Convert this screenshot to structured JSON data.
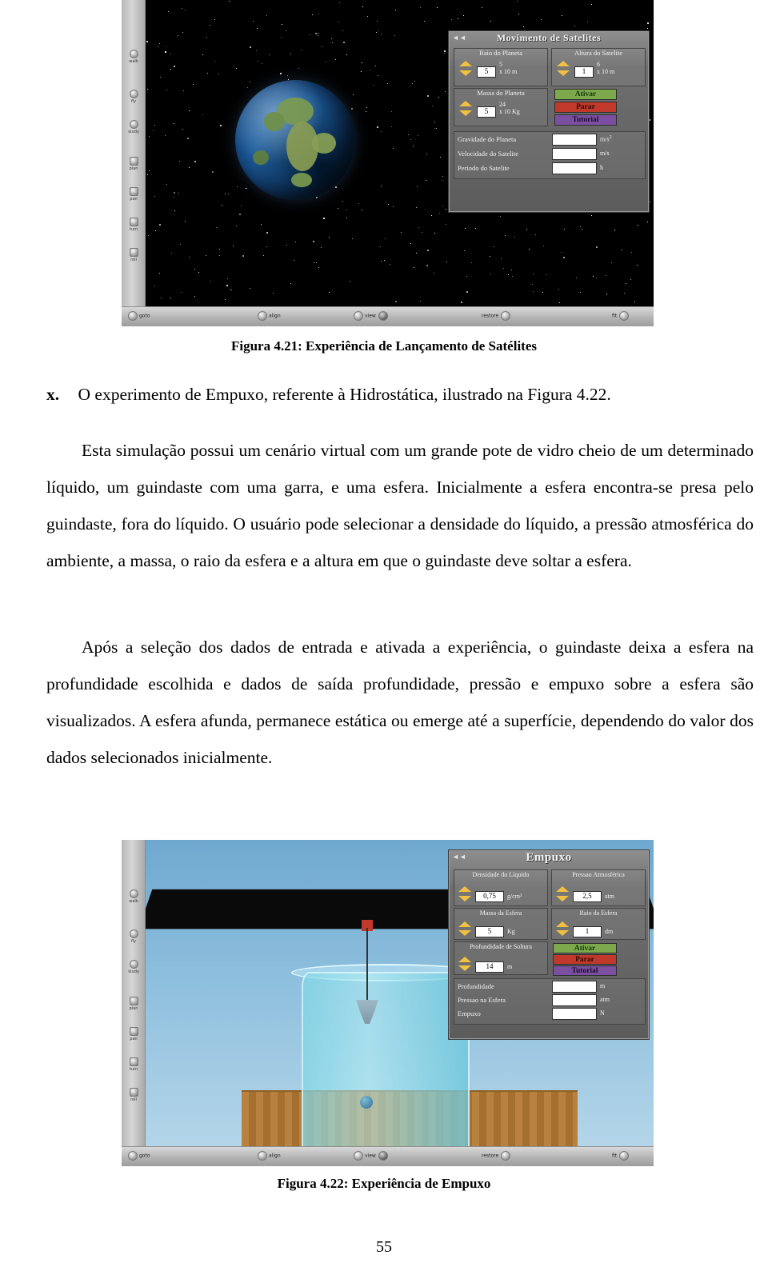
{
  "figure1": {
    "caption": "Figura 4.21: Experiência de Lançamento de Satélites",
    "panel": {
      "title": "Movimento de Satelites",
      "back_icon": "back-arrow-icon",
      "groups": [
        {
          "label": "Raio do Planeta",
          "value": "5",
          "unit_prefix": "x 10",
          "unit_exp": "5",
          "unit_suffix": "m"
        },
        {
          "label": "Altura do Satelite",
          "value": "1",
          "unit_prefix": "x 10",
          "unit_exp": "6",
          "unit_suffix": "m"
        },
        {
          "label": "Massa do Planeta",
          "value": "5",
          "unit_prefix": "x 10",
          "unit_exp": "24",
          "unit_suffix": "Kg"
        }
      ],
      "buttons": [
        {
          "label": "Ativar",
          "color": "#7da84b"
        },
        {
          "label": "Parar",
          "color": "#c0392b"
        },
        {
          "label": "Tutorial",
          "color": "#7a4fa0"
        }
      ],
      "outputs": [
        {
          "label": "Gravidade do Planeta",
          "value": "",
          "unit": "m/s",
          "exp": "2"
        },
        {
          "label": "Velocidade do Satelite",
          "value": "",
          "unit": "m/s",
          "exp": ""
        },
        {
          "label": "Periodo do Satelite",
          "value": "",
          "unit": "h",
          "exp": ""
        }
      ]
    },
    "toolbar_left": [
      "walk",
      "fly",
      "study",
      "plan",
      "pan",
      "turn",
      "roll"
    ],
    "toolbar_bottom": [
      "goto",
      "align",
      "view",
      "restore",
      "fit"
    ]
  },
  "body": {
    "bullet_mark": "x.",
    "bullet_text": "O experimento de Empuxo, referente à Hidrostática, ilustrado na Figura 4.22.",
    "paragraph1": "Esta simulação possui um cenário virtual com um grande pote de vidro cheio de um determinado líquido, um guindaste com uma garra, e uma esfera. Inicialmente a esfera encontra-se presa pelo guindaste, fora do líquido. O usuário pode selecionar a densidade do líquido, a pressão atmosférica do ambiente, a massa, o raio da esfera e a altura em que o guindaste deve soltar a esfera.",
    "paragraph2": "Após a seleção dos dados de entrada e ativada a experiência, o guindaste deixa a esfera na profundidade escolhida e dados de saída profundidade, pressão e empuxo sobre a esfera são visualizados. A esfera afunda, permanece estática ou emerge até a superfície, dependendo do valor dos dados selecionados inicialmente."
  },
  "figure2": {
    "caption": "Figura 4.22: Experiência de Empuxo",
    "panel": {
      "title": "Empuxo",
      "back_icon": "back-arrow-icon",
      "groups": [
        {
          "label": "Densidade do Líquido",
          "value": "0,75",
          "unit": "g/cm³"
        },
        {
          "label": "Pressao Atmosférica",
          "value": "2,5",
          "unit": "atm"
        },
        {
          "label": "Massa da Esfera",
          "value": "5",
          "unit": "Kg"
        },
        {
          "label": "Raio da Esfera",
          "value": "1",
          "unit": "dm"
        },
        {
          "label": "Profundidade de Soltura",
          "value": "14",
          "unit": "m"
        }
      ],
      "buttons": [
        {
          "label": "Ativar",
          "color": "#7da84b"
        },
        {
          "label": "Parar",
          "color": "#c0392b"
        },
        {
          "label": "Tutorial",
          "color": "#7a4fa0"
        }
      ],
      "outputs": [
        {
          "label": "Profundidade",
          "value": "",
          "unit": "m"
        },
        {
          "label": "Pressao na Esfera",
          "value": "",
          "unit": "atm"
        },
        {
          "label": "Empuxo",
          "value": "",
          "unit": "N"
        }
      ]
    },
    "toolbar_left": [
      "walk",
      "fly",
      "study",
      "plan",
      "pan",
      "turn",
      "roll"
    ],
    "toolbar_bottom": [
      "goto",
      "align",
      "view",
      "restore",
      "fit"
    ]
  },
  "page_number": "55"
}
